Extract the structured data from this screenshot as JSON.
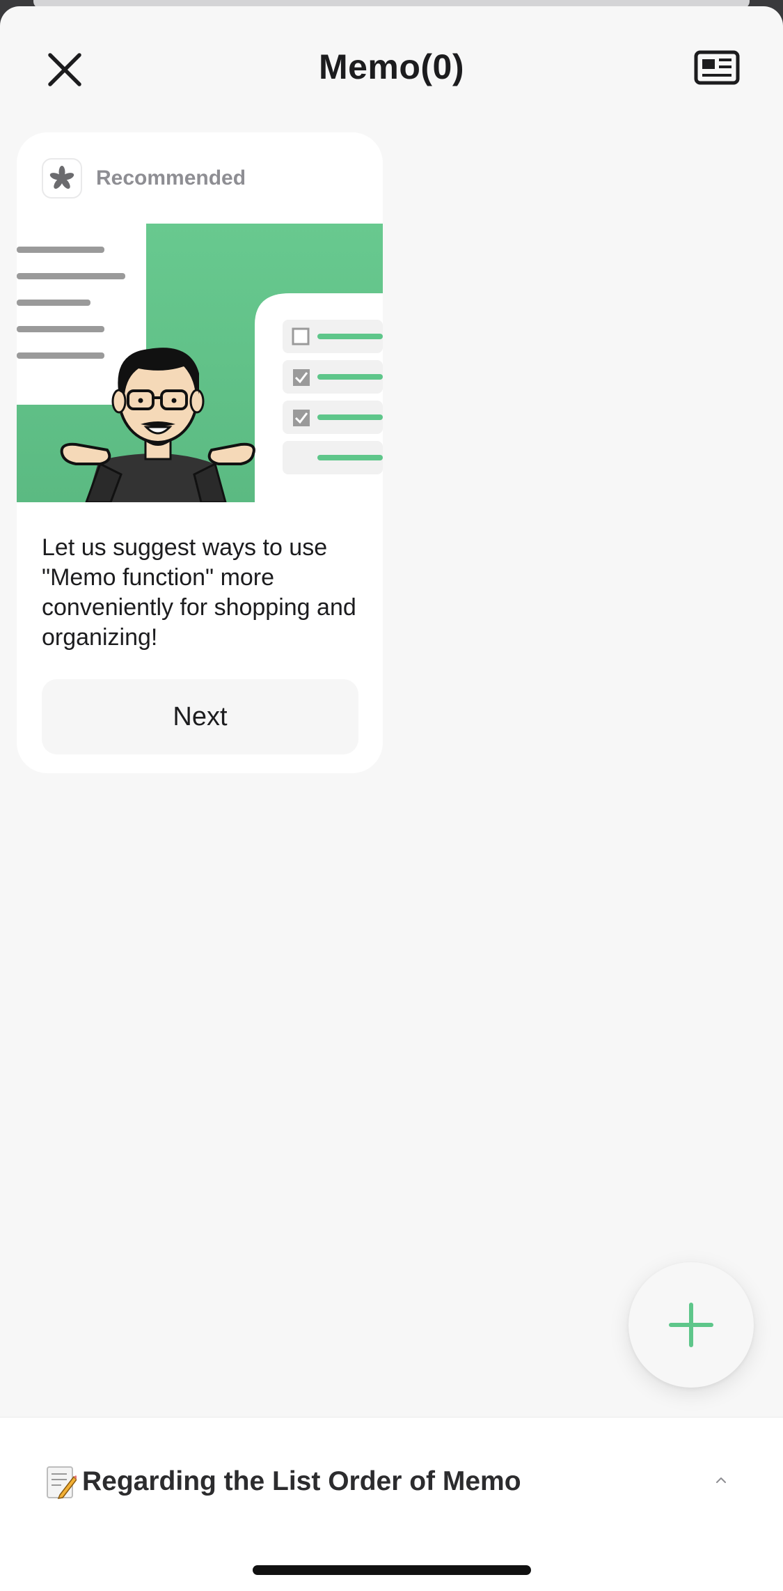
{
  "header": {
    "title": "Memo(0)",
    "close_icon": "close-icon",
    "view_icon": "list-view-icon"
  },
  "card": {
    "badge_label": "Recommended",
    "badge_icon": "flower-logo-icon",
    "text": "Let us suggest ways to use \"Memo function\" more conveniently for shopping and organizing!",
    "next_label": "Next"
  },
  "fab": {
    "icon": "plus-icon"
  },
  "bottom_panel": {
    "emoji": "📝",
    "title": "Regarding the List Order of Memo",
    "chevron_icon": "chevron-up-icon"
  },
  "colors": {
    "accent_green": "#5ec68a",
    "background": "#f7f7f7",
    "text_primary": "#1c1c1e",
    "text_secondary": "#8e8e93"
  }
}
